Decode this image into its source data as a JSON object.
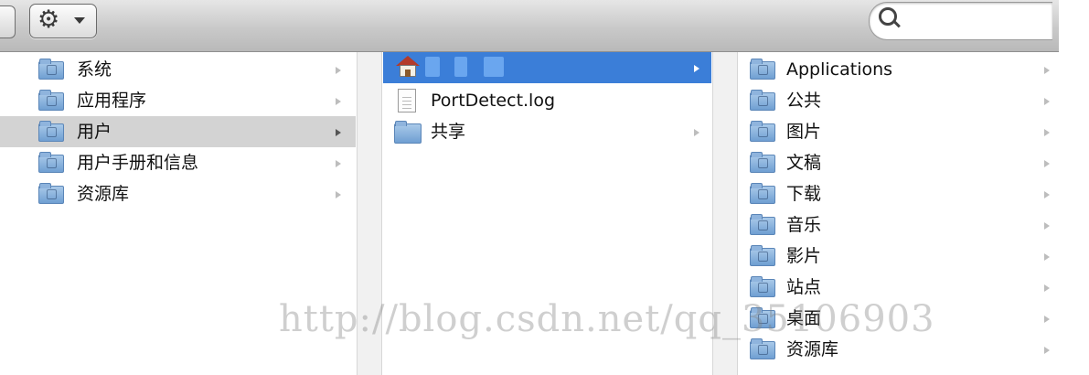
{
  "toolbar": {
    "action_icon": "gear-icon",
    "search_icon": "search-icon",
    "search_value": ""
  },
  "column1": {
    "items": [
      {
        "label": "系统",
        "icon": "system-folder-icon"
      },
      {
        "label": "应用程序",
        "icon": "applications-folder-icon"
      },
      {
        "label": "用户",
        "icon": "users-folder-icon"
      },
      {
        "label": "用户手册和信息",
        "icon": "manuals-folder-icon"
      },
      {
        "label": "资源库",
        "icon": "library-folder-icon"
      }
    ],
    "selected": "用户"
  },
  "column2": {
    "items": [
      {
        "label": "",
        "icon": "home-icon"
      },
      {
        "label": "PortDetect.log",
        "icon": "document-icon"
      },
      {
        "label": "共享",
        "icon": "shared-folder-icon"
      }
    ]
  },
  "column3": {
    "items": [
      {
        "label": "Applications",
        "icon": "applications-folder-icon"
      },
      {
        "label": "公共",
        "icon": "public-folder-icon"
      },
      {
        "label": "图片",
        "icon": "pictures-folder-icon"
      },
      {
        "label": "文稿",
        "icon": "documents-folder-icon"
      },
      {
        "label": "下载",
        "icon": "downloads-folder-icon"
      },
      {
        "label": "音乐",
        "icon": "music-folder-icon"
      },
      {
        "label": "影片",
        "icon": "movies-folder-icon"
      },
      {
        "label": "站点",
        "icon": "sites-folder-icon"
      },
      {
        "label": "桌面",
        "icon": "desktop-folder-icon"
      },
      {
        "label": "资源库",
        "icon": "library-folder-icon"
      }
    ]
  },
  "watermark": "http://blog.csdn.net/qq_35106903",
  "colors": {
    "selection_blue": "#3b7ed8",
    "selection_gray": "#d3d3d3"
  }
}
